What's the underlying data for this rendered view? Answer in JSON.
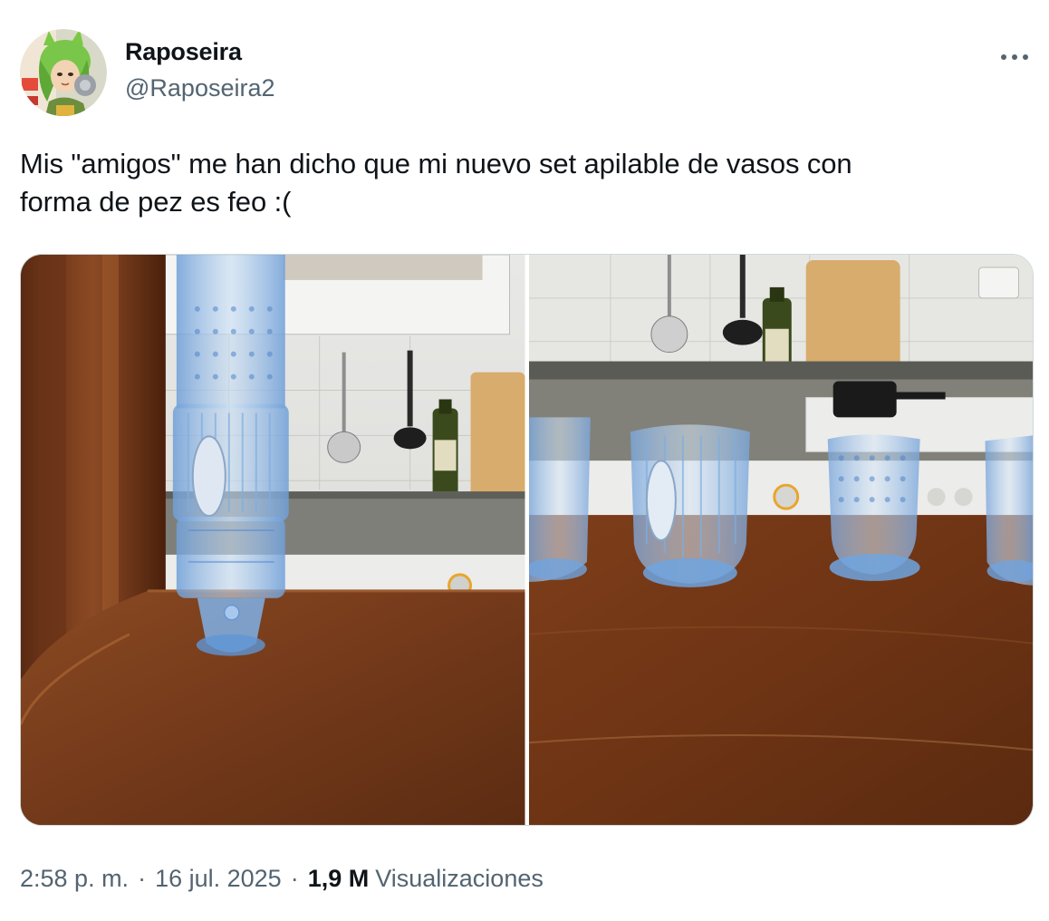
{
  "author": {
    "display_name": "Raposeira",
    "handle": "@Raposeira2",
    "avatar_icon": "profile-avatar-illustration"
  },
  "more_icon": "more-horizontal-icon",
  "tweet": {
    "text": "Mis \"amigos\" me han dicho que mi nuevo set apilable de vasos con\nforma de pez es feo :("
  },
  "media": {
    "photos": [
      {
        "icon": "photo-stacked-glasses"
      },
      {
        "icon": "photo-glasses-on-counter"
      }
    ]
  },
  "meta": {
    "time": "2:58 p. m.",
    "separator": "·",
    "date": "16 jul. 2025",
    "views_count": "1,9 M",
    "views_label": "Visualizaciones"
  },
  "colors": {
    "text_primary": "#0f1419",
    "text_secondary": "#536471",
    "border": "#cfd9de",
    "glass_blue": "#8fb8e6",
    "wood": "#7a3f1c"
  }
}
